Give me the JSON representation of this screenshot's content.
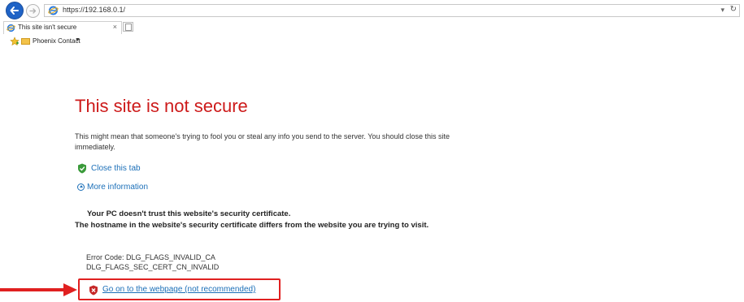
{
  "browser": {
    "url": "https://192.168.0.1/",
    "address_dropdown": "▾",
    "refresh_glyph": "↻",
    "tab_title": "This site isn't secure",
    "tab_close": "×",
    "favorites_label": "Phoenix Contact",
    "favorites_caret": "▼"
  },
  "page": {
    "heading": "This site is not secure",
    "description": "This might mean that someone's trying to fool you or steal any info you send to the server. You should close this site immediately.",
    "close_tab_label": "Close this tab",
    "more_info_label": "More information",
    "trust_text": "Your PC doesn't trust this website's security certificate.",
    "hostname_text": "The hostname in the website's security certificate differs from the website you are trying to visit.",
    "error_code_line1": "Error Code: DLG_FLAGS_INVALID_CA",
    "error_code_line2": "DLG_FLAGS_SEC_CERT_CN_INVALID",
    "go_on_label": "Go on to the webpage (not recommended)"
  },
  "colors": {
    "heading_red": "#cd1a1a",
    "link_blue": "#1b6fb8",
    "highlight_red": "#e02020"
  },
  "icons": [
    "back-arrow-icon",
    "forward-arrow-icon",
    "ie-icon",
    "refresh-icon",
    "new-tab-icon",
    "favorites-star-icon",
    "folder-icon",
    "green-shield-icon",
    "info-chevron-icon",
    "red-shield-icon",
    "red-arrow-icon"
  ]
}
